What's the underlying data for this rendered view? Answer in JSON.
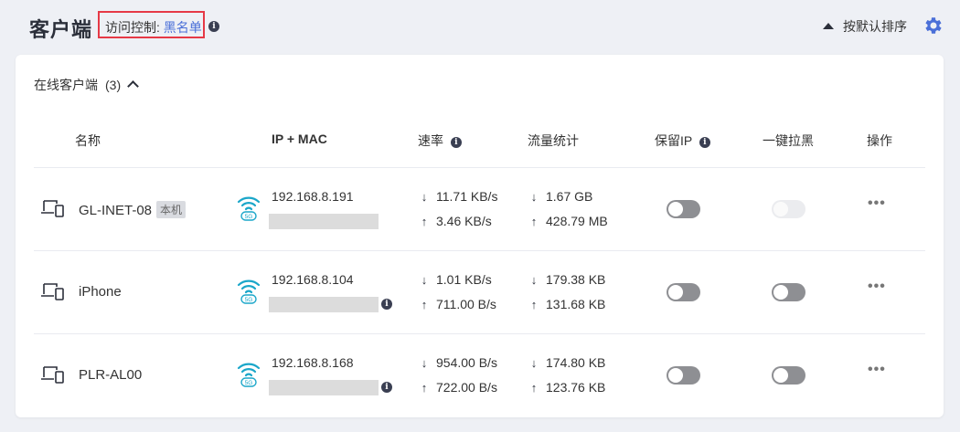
{
  "header": {
    "title": "客户端",
    "access_label": "访问控制: ",
    "access_value": "黑名单",
    "sort_label": "按默认排序"
  },
  "section": {
    "title": "在线客户端",
    "count": "(3)"
  },
  "columns": {
    "name": "名称",
    "ip_mac": "IP + MAC",
    "rate": "速率",
    "traffic": "流量统计",
    "reserve_ip": "保留IP",
    "blacklist": "一键拉黑",
    "actions": "操作"
  },
  "clients": [
    {
      "name": "GL-INET-08",
      "badge": "本机",
      "band": "5G",
      "ip": "192.168.8.191",
      "rate_down": "11.71 KB/s",
      "rate_up": "3.46 KB/s",
      "traffic_down": "1.67 GB",
      "traffic_up": "428.79 MB",
      "reserve_ip_on": false,
      "blacklist_disabled": true
    },
    {
      "name": "iPhone",
      "badge": "",
      "band": "5G",
      "ip": "192.168.8.104",
      "rate_down": "1.01 KB/s",
      "rate_up": "711.00 B/s",
      "traffic_down": "179.38 KB",
      "traffic_up": "131.68 KB",
      "reserve_ip_on": false,
      "blacklist_disabled": false
    },
    {
      "name": "PLR-AL00",
      "badge": "",
      "band": "5G",
      "ip": "192.168.8.168",
      "rate_down": "954.00 B/s",
      "rate_up": "722.00 B/s",
      "traffic_down": "174.80 KB",
      "traffic_up": "123.76 KB",
      "reserve_ip_on": false,
      "blacklist_disabled": false
    }
  ],
  "icons": {
    "down_arrow": "↓",
    "up_arrow": "↑",
    "more": "•••"
  },
  "colors": {
    "accent": "#4a6fd8",
    "highlight_border": "#e63946",
    "wifi": "#1aa6c9"
  }
}
